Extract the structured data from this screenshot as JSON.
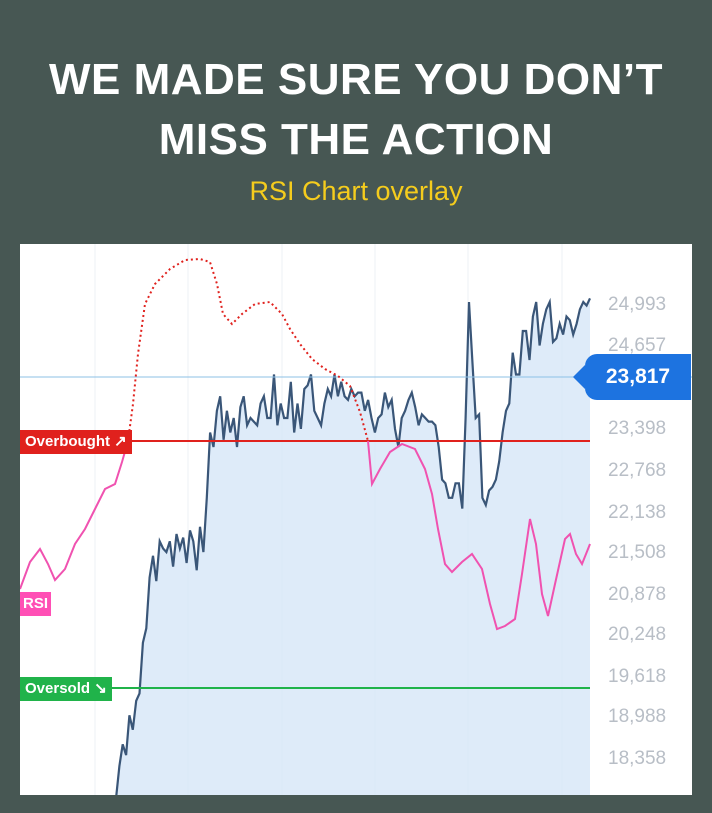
{
  "headline": {
    "line1": "WE MADE SURE YOU DON’T",
    "line2": "MISS THE ACTION"
  },
  "subheadline": "RSI Chart overlay",
  "chart": {
    "current_price": "23,817",
    "overbought_label": "Overbought ↗",
    "oversold_label": "Oversold ↘",
    "rsi_label": "RSI",
    "colors": {
      "price_line": "#3a5678",
      "area_fill": "#d6e6f8",
      "rsi_line": "#f052b0",
      "rsi_overbought_segment": "#e0211d",
      "overbought_line": "#e0211d",
      "oversold_line": "#20b34a",
      "current_price_line": "#8cc0e6",
      "price_badge": "#1d73e0"
    }
  },
  "chart_data": {
    "type": "line",
    "title": "",
    "ylabel": "",
    "xlabel": "",
    "y_ticks": [
      "24,993",
      "24,657",
      "23,398",
      "22,768",
      "22,138",
      "21,508",
      "20,878",
      "20,248",
      "19,618",
      "18,988",
      "18,358"
    ],
    "ylim": [
      18100,
      25700
    ],
    "current_value": 23817,
    "grid": true,
    "x": [
      0,
      1,
      2,
      3,
      4,
      5,
      6,
      7,
      8,
      9,
      10,
      11,
      12,
      13,
      14,
      15,
      16,
      17,
      18,
      19,
      20,
      21,
      22,
      23,
      24,
      25,
      26,
      27,
      28,
      29,
      30,
      31,
      32,
      33,
      34,
      35,
      36,
      37,
      38,
      39,
      40,
      41,
      42,
      43,
      44,
      45,
      46,
      47,
      48,
      49,
      50,
      51,
      52,
      53,
      54,
      55,
      56,
      57,
      58,
      59,
      60,
      61,
      62,
      63,
      64,
      65,
      66,
      67,
      68,
      69,
      70,
      71,
      72,
      73,
      74,
      75,
      76,
      77,
      78,
      79,
      80,
      81,
      82,
      83,
      84,
      85,
      86,
      87,
      88,
      89,
      90,
      91,
      92,
      93,
      94,
      95,
      96,
      97,
      98,
      99,
      100,
      101,
      102,
      103,
      104,
      105,
      106,
      107,
      108,
      109,
      110,
      111,
      112,
      113,
      114,
      115,
      116,
      117,
      118,
      119
    ],
    "series": [
      {
        "values": [
          18050,
          18500,
          18800,
          18650,
          19200,
          19000,
          19400,
          19500,
          20200,
          20400,
          21100,
          21400,
          21050,
          21600,
          21500,
          21450,
          21600,
          21250,
          21700,
          21500,
          21650,
          21300,
          21750,
          21600,
          21200,
          21800,
          21450,
          22200,
          23100,
          22900,
          23400,
          23600,
          23000,
          23400,
          23100,
          23300,
          22900,
          23450,
          23600,
          23200,
          23300,
          23250,
          23200,
          23500,
          23600,
          23300,
          23300,
          23900,
          23200,
          23500,
          23300,
          23300,
          23800,
          23100,
          23500,
          23150,
          23700,
          23750,
          23900,
          23400,
          23300,
          23200,
          23500,
          23700,
          23600,
          23900,
          23600,
          23800,
          23600,
          23550,
          23700,
          23600,
          23650,
          23650,
          23400,
          23550,
          23300,
          23100,
          23300,
          23350,
          23650,
          23450,
          23550,
          23150,
          22900,
          23300,
          23400,
          23550,
          23650,
          23450,
          23200,
          23350,
          23300,
          23250,
          23250,
          23200,
          22900,
          22450,
          22400,
          22200,
          22200,
          22400,
          22400,
          22050,
          23300,
          24900,
          24100,
          23300,
          23350,
          22200,
          22100,
          22300,
          22350,
          22450,
          22700,
          23100,
          23400,
          23500,
          24200,
          23900,
          23900,
          24500,
          24500,
          24100,
          24700,
          24900,
          24300,
          24600,
          24800,
          24900,
          24350,
          24400,
          24600,
          24450,
          24700,
          24650,
          24450,
          24600,
          24800,
          24900,
          24850,
          24950
        ]
      }
    ]
  }
}
